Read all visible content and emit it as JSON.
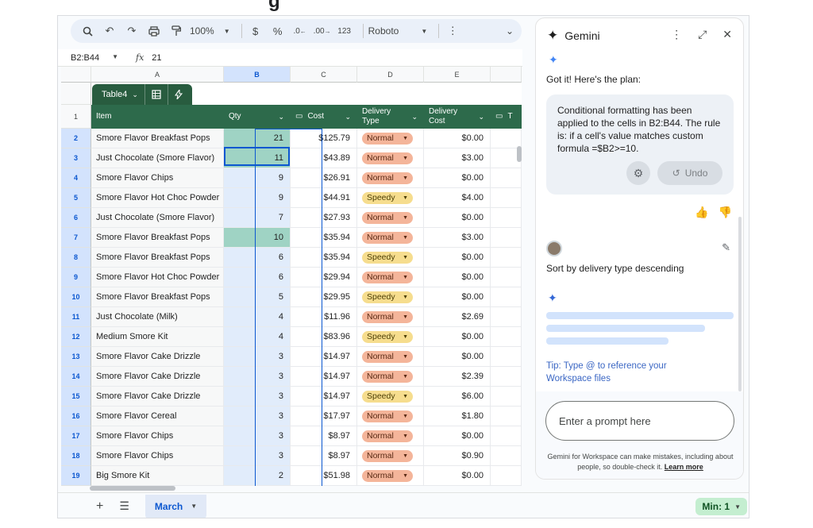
{
  "toolbar": {
    "zoom": "100%",
    "font": "Roboto",
    "currency": "$",
    "percent": "%",
    "dec_decrease": ".0",
    "dec_increase": ".00",
    "number_format": "123"
  },
  "formula_bar": {
    "range": "B2:B44",
    "fx": "fx",
    "value": "21"
  },
  "columns": [
    "A",
    "B",
    "C",
    "D",
    "E"
  ],
  "table": {
    "name": "Table4",
    "headers": {
      "item": "Item",
      "qty": "Qty",
      "cost": "Cost",
      "delivery_type": "Delivery Type",
      "delivery_cost": "Delivery Cost",
      "extra": "T"
    },
    "header_row_num": "1",
    "rows": [
      {
        "num": "2",
        "item": "Smore Flavor Breakfast Pops",
        "qty": "21",
        "cost": "$125.79",
        "type": "Normal",
        "dcost": "$0.00"
      },
      {
        "num": "3",
        "item": "Just Chocolate (Smore Flavor)",
        "qty": "11",
        "cost": "$43.89",
        "type": "Normal",
        "dcost": "$3.00"
      },
      {
        "num": "4",
        "item": "Smore Flavor Chips",
        "qty": "9",
        "cost": "$26.91",
        "type": "Normal",
        "dcost": "$0.00"
      },
      {
        "num": "5",
        "item": "Smore Flavor Hot Choc Powder",
        "qty": "9",
        "cost": "$44.91",
        "type": "Speedy",
        "dcost": "$4.00"
      },
      {
        "num": "6",
        "item": "Just Chocolate (Smore Flavor)",
        "qty": "7",
        "cost": "$27.93",
        "type": "Normal",
        "dcost": "$0.00"
      },
      {
        "num": "7",
        "item": "Smore Flavor Breakfast Pops",
        "qty": "10",
        "cost": "$35.94",
        "type": "Normal",
        "dcost": "$3.00"
      },
      {
        "num": "8",
        "item": "Smore Flavor Breakfast Pops",
        "qty": "6",
        "cost": "$35.94",
        "type": "Speedy",
        "dcost": "$0.00"
      },
      {
        "num": "9",
        "item": "Smore Flavor Hot Choc Powder",
        "qty": "6",
        "cost": "$29.94",
        "type": "Normal",
        "dcost": "$0.00"
      },
      {
        "num": "10",
        "item": "Smore Flavor Breakfast Pops",
        "qty": "5",
        "cost": "$29.95",
        "type": "Speedy",
        "dcost": "$0.00"
      },
      {
        "num": "11",
        "item": "Just Chocolate (Milk)",
        "qty": "4",
        "cost": "$11.96",
        "type": "Normal",
        "dcost": "$2.69"
      },
      {
        "num": "12",
        "item": "Medium Smore Kit",
        "qty": "4",
        "cost": "$83.96",
        "type": "Speedy",
        "dcost": "$0.00"
      },
      {
        "num": "13",
        "item": "Smore Flavor Cake Drizzle",
        "qty": "3",
        "cost": "$14.97",
        "type": "Normal",
        "dcost": "$0.00"
      },
      {
        "num": "14",
        "item": "Smore Flavor Cake Drizzle",
        "qty": "3",
        "cost": "$14.97",
        "type": "Normal",
        "dcost": "$2.39"
      },
      {
        "num": "15",
        "item": "Smore Flavor Cake Drizzle",
        "qty": "3",
        "cost": "$14.97",
        "type": "Speedy",
        "dcost": "$6.00"
      },
      {
        "num": "16",
        "item": "Smore Flavor Cereal",
        "qty": "3",
        "cost": "$17.97",
        "type": "Normal",
        "dcost": "$1.80"
      },
      {
        "num": "17",
        "item": "Smore Flavor Chips",
        "qty": "3",
        "cost": "$8.97",
        "type": "Normal",
        "dcost": "$0.00"
      },
      {
        "num": "18",
        "item": "Smore Flavor Chips",
        "qty": "3",
        "cost": "$8.97",
        "type": "Normal",
        "dcost": "$0.90"
      },
      {
        "num": "19",
        "item": "Big Smore Kit",
        "qty": "2",
        "cost": "$51.98",
        "type": "Normal",
        "dcost": "$0.00"
      }
    ]
  },
  "bottom": {
    "sheet_tab": "March",
    "stat": "Min: 1"
  },
  "gemini": {
    "title": "Gemini",
    "plan_intro": "Got it! Here's the plan:",
    "plan_message": "Conditional formatting has been applied to the cells in B2:B44. The rule is: if a cell's value matches custom formula =$B2>=10.",
    "undo_label": "Undo",
    "user_prompt": "Sort by delivery type descending",
    "tip": "Tip: Type @ to reference your Workspace files",
    "input_placeholder": "Enter a prompt here",
    "disclaimer": "Gemini for Workspace can make mistakes, including about people, so double-check it.",
    "learn_more": "Learn more"
  },
  "colors": {
    "table_header": "#2d6a4b",
    "normal_chip": "#f4b59a",
    "speedy_chip": "#f6dd8e",
    "qty_highlight": "#9fd3c4",
    "selection": "#0b57d0"
  }
}
